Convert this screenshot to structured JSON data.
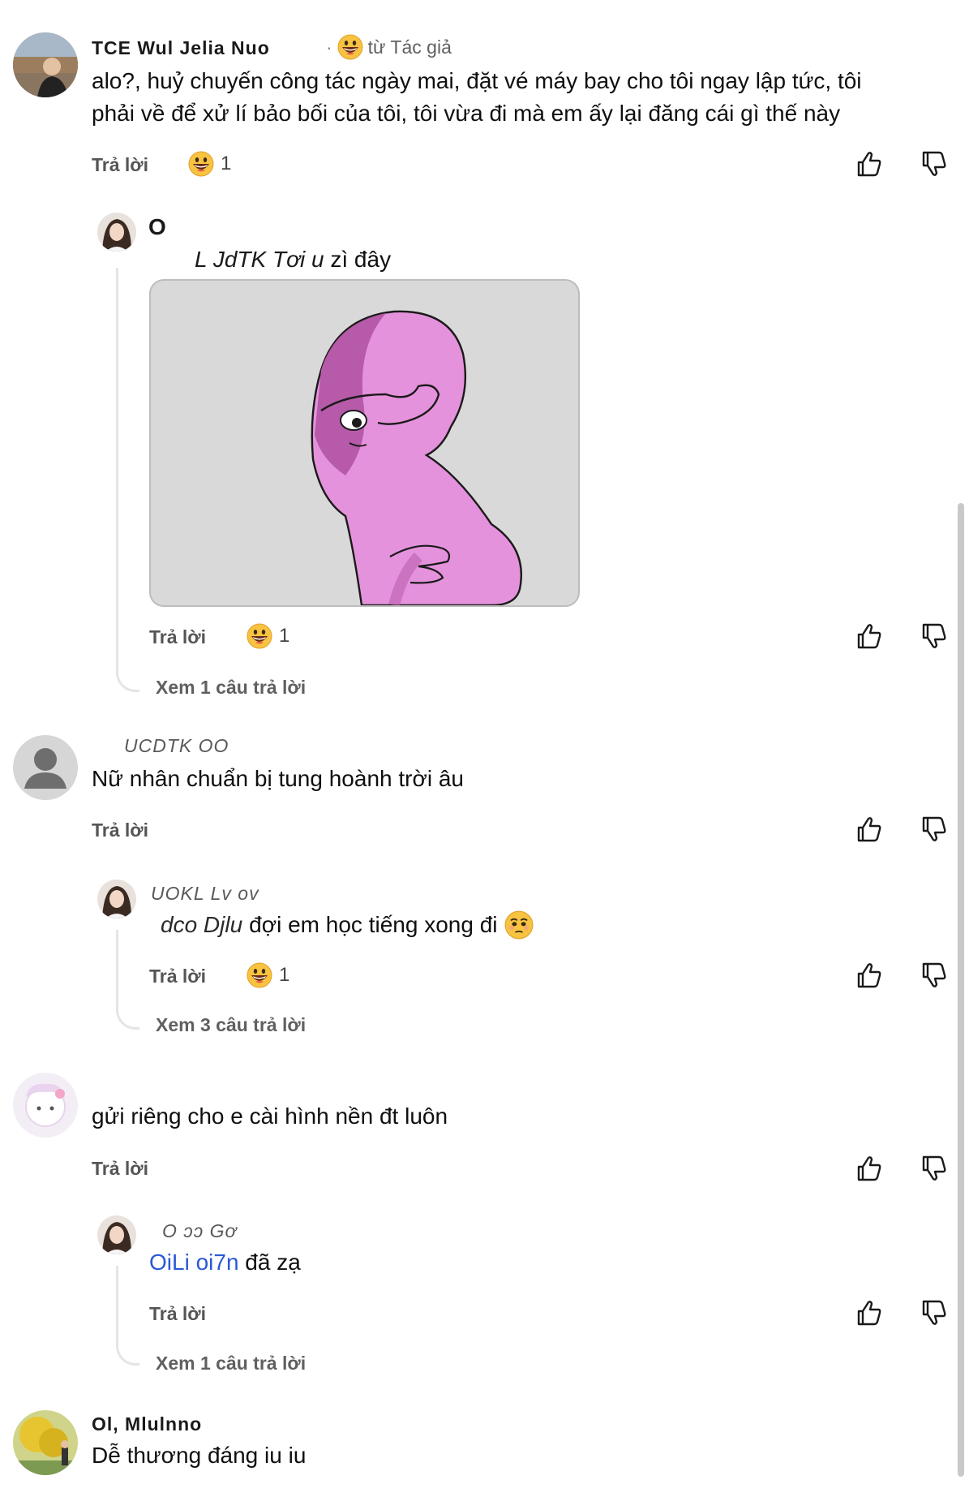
{
  "comments": [
    {
      "author": "TCE Wul Jelia Nuo",
      "author_badge": "từ Tác giả",
      "lines": [
        "alo?, huỷ chuyến công tác ngày mai, đặt vé máy bay cho tôi ngay lập tức, tôi",
        "phải về để xử lí bảo bối của tôi, tôi vừa đi mà em ấy lại đăng cái gì thế này"
      ],
      "reply_label": "Trả lời",
      "reaction_count": "1"
    },
    {
      "reply_author": "O",
      "reply_text": "zì đây",
      "reply_text_prefix": "L JdTK Tơi u",
      "reply_label": "Trả lời",
      "reaction_count": "1",
      "view_more": "Xem 1 câu trả lời",
      "image": {
        "alt_icon": "pink-cartoon-facepalm-image"
      }
    },
    {
      "author": "UCDTK OO",
      "text": "Nữ nhân chuẩn bị tung hoành trời âu",
      "reply_label": "Trả lời"
    },
    {
      "reply_author": "UOKL Lv ov",
      "mention": "dco Djlu",
      "reply_text": "đợi em học tiếng xong đi",
      "reply_label": "Trả lời",
      "reaction_count": "1",
      "view_more": "Xem 3 câu trả lời"
    },
    {
      "text": "gửi riêng cho e cài hình nền đt luôn",
      "reply_label": "Trả lời"
    },
    {
      "reply_author": "O ɔɔ Gơ",
      "mention": "OiLi oi7n",
      "reply_text": "đã zạ",
      "reply_label": "Trả lời",
      "view_more": "Xem 1 câu trả lời"
    },
    {
      "author": "Ol, Mlulnno",
      "text": "Dễ thương đáng iu iu"
    }
  ],
  "icons": {
    "like": "thumb-up-icon",
    "dislike": "thumb-down-icon",
    "reaction": "grinning-face-emoji",
    "sad": "pleading-face-emoji"
  },
  "colors": {
    "mention": "#2a58d6",
    "image_bg": "#d8d8d8",
    "figure": "#e08ad8"
  }
}
